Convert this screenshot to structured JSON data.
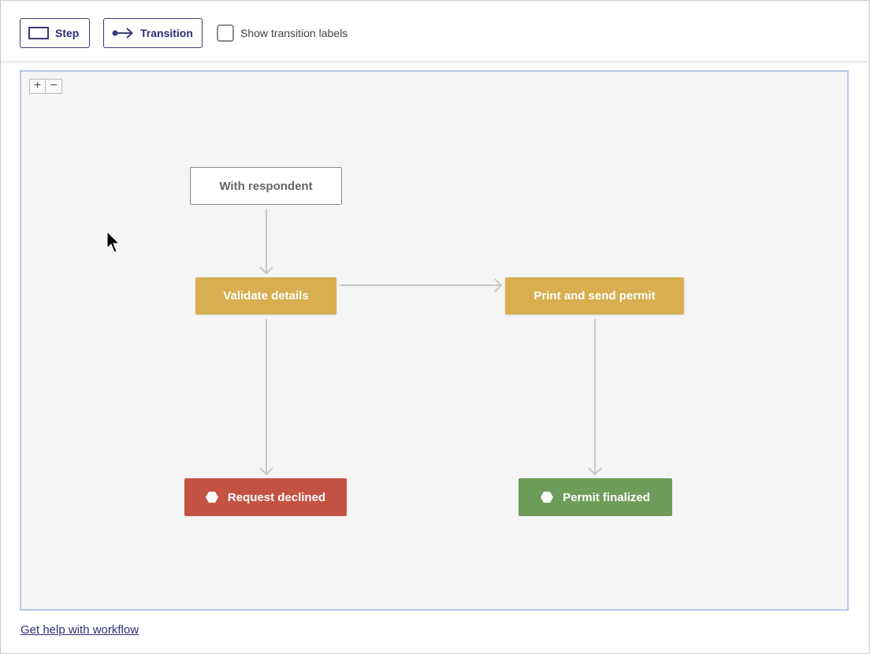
{
  "toolbar": {
    "step_label": "Step",
    "transition_label": "Transition",
    "show_labels_text": "Show transition labels",
    "show_labels_checked": false
  },
  "canvas": {
    "zoom_in": "+",
    "zoom_out": "−"
  },
  "workflow": {
    "steps": [
      {
        "id": "with-respondent",
        "label": "With respondent",
        "type": "start"
      },
      {
        "id": "validate-details",
        "label": "Validate details",
        "type": "task"
      },
      {
        "id": "print-and-send-permit",
        "label": "Print and send permit",
        "type": "task"
      },
      {
        "id": "request-declined",
        "label": "Request declined",
        "type": "end"
      },
      {
        "id": "permit-finalized",
        "label": "Permit finalized",
        "type": "end"
      }
    ],
    "transitions": [
      {
        "from": "With respondent",
        "to": "Validate details"
      },
      {
        "from": "Validate details",
        "to": "Print and send permit"
      },
      {
        "from": "Validate details",
        "to": "Request declined"
      },
      {
        "from": "Print and send permit",
        "to": "Permit finalized"
      }
    ]
  },
  "colors": {
    "accent": "#2f2e76",
    "task": "#d9ae4f",
    "declined": "#c45242",
    "finalized": "#6e9c5a",
    "edge": "#c8c8c8",
    "canvas_border": "#b6c3ec"
  },
  "footer": {
    "help_link": "Get help with workflow"
  }
}
